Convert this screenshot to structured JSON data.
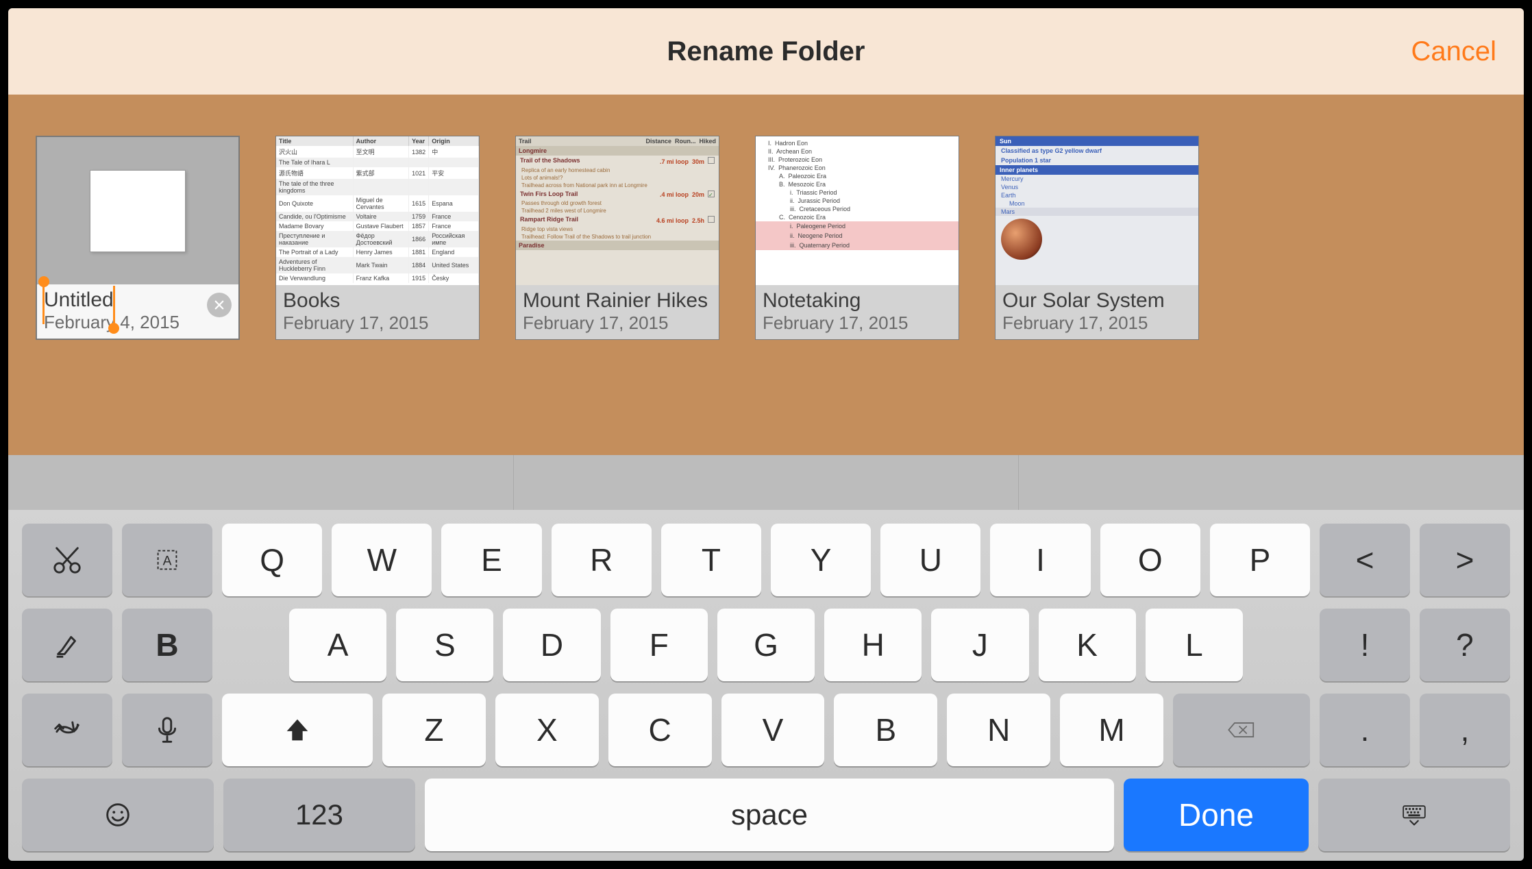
{
  "header": {
    "title": "Rename Folder",
    "cancel": "Cancel"
  },
  "documents": [
    {
      "title": "Untitled",
      "date": "February    4, 2015",
      "editing": true
    },
    {
      "title": "Books",
      "date": "February 17, 2015"
    },
    {
      "title": "Mount Rainier Hikes",
      "date": "February 17, 2015"
    },
    {
      "title": "Notetaking",
      "date": "February 17, 2015"
    },
    {
      "title": "Our Solar System",
      "date": "February 17, 2015"
    }
  ],
  "keyboard": {
    "row1": [
      "Q",
      "W",
      "E",
      "R",
      "T",
      "Y",
      "U",
      "I",
      "O",
      "P"
    ],
    "row2": [
      "A",
      "S",
      "D",
      "F",
      "G",
      "H",
      "J",
      "K",
      "L"
    ],
    "row3": [
      "Z",
      "X",
      "C",
      "V",
      "B",
      "N",
      "M"
    ],
    "side_row1": [
      "<",
      ">"
    ],
    "side_row2": [
      "!",
      "?"
    ],
    "side_row3": [
      ".",
      ","
    ],
    "numbers": "123",
    "space": "space",
    "done": "Done"
  }
}
